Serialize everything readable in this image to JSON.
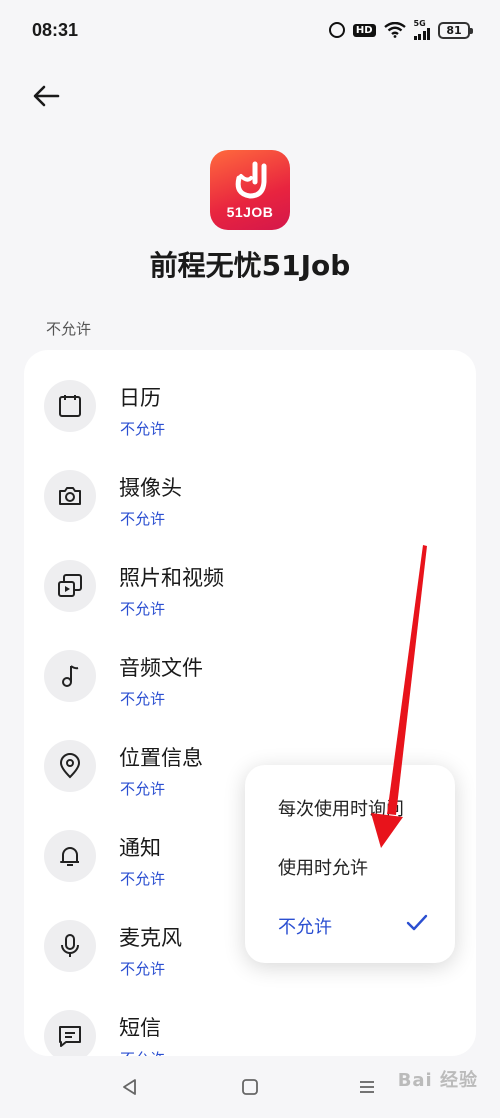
{
  "status_bar": {
    "time": "08:31",
    "hd": "HD",
    "network": "5G",
    "battery": "81"
  },
  "app": {
    "icon_text": "51JOB",
    "name": "前程无忧51Job"
  },
  "section": {
    "header": "不允许"
  },
  "permissions": [
    {
      "title": "日历",
      "status": "不允许",
      "icon": "calendar-icon"
    },
    {
      "title": "摄像头",
      "status": "不允许",
      "icon": "camera-icon"
    },
    {
      "title": "照片和视频",
      "status": "不允许",
      "icon": "photos-videos-icon"
    },
    {
      "title": "音频文件",
      "status": "不允许",
      "icon": "music-note-icon"
    },
    {
      "title": "位置信息",
      "status": "不允许",
      "icon": "location-pin-icon"
    },
    {
      "title": "通知",
      "status": "不允许",
      "icon": "bell-icon"
    },
    {
      "title": "麦克风",
      "status": "不允许",
      "icon": "microphone-icon"
    },
    {
      "title": "短信",
      "status": "不允许",
      "icon": "message-icon"
    }
  ],
  "dropdown": {
    "options": [
      "每次使用时询问",
      "使用时允许",
      "不允许"
    ],
    "selected": "不允许"
  },
  "watermark": "Bai 经验",
  "colors": {
    "accent": "#2b4fd1",
    "arrow": "#e8131b",
    "app_icon": "#e8243f"
  }
}
